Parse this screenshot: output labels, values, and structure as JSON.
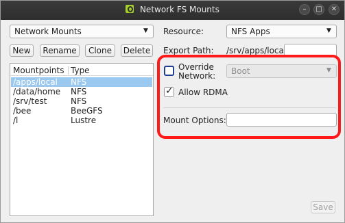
{
  "window": {
    "title": "Network FS Mounts",
    "buttons": {
      "minimize": "–",
      "maximize": "□",
      "close": "✕"
    }
  },
  "left": {
    "profile_select": "Network Mounts",
    "buttons": {
      "new": "New",
      "rename": "Rename",
      "clone": "Clone",
      "delete": "Delete"
    },
    "list": {
      "columns": [
        "Mountpoints",
        "Type"
      ],
      "rows": [
        {
          "mount": "/apps/local",
          "type": "NFS",
          "selected": true
        },
        {
          "mount": "/data/home",
          "type": "NFS"
        },
        {
          "mount": "/srv/test",
          "type": "NFS"
        },
        {
          "mount": "/bee",
          "type": "BeeGFS"
        },
        {
          "mount": "/l",
          "type": "Lustre"
        }
      ]
    }
  },
  "right": {
    "resource_label": "Resource:",
    "resource_value": "NFS Apps",
    "export_path_label": "Export Path:",
    "export_path_value": "/srv/apps/local/",
    "override_network_label_1": "Override",
    "override_network_label_2": "Network:",
    "override_network_checked": false,
    "override_network_value": "Boot",
    "allow_rdma_label": "Allow RDMA",
    "allow_rdma_checked": true,
    "mount_options_label": "Mount Options:",
    "mount_options_value": "",
    "save_label": "Save"
  },
  "colors": {
    "titlebar": "#2e2e2e",
    "selection": "#9bc8ee",
    "highlight": "#ff1a1a",
    "app_icon": "#a6d02a"
  },
  "icons": {
    "app": "network-app-icon",
    "dropdown": "chevron-down-icon",
    "check": "checkmark-icon"
  }
}
